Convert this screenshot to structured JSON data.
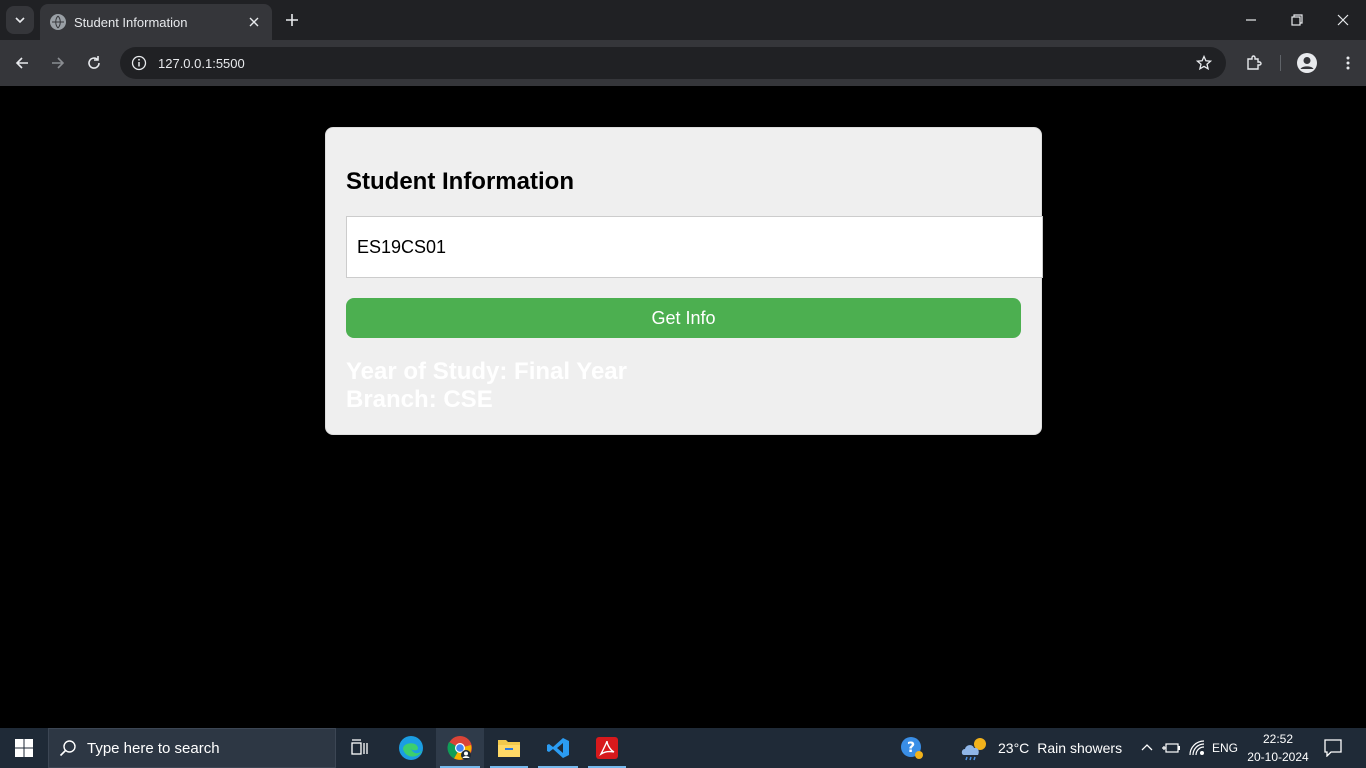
{
  "browser": {
    "tab_title": "Student Information",
    "url": "127.0.0.1:5500"
  },
  "page": {
    "heading": "Student Information",
    "student_id_value": "ES19CS01",
    "button_label": "Get Info",
    "result_year": "Year of Study: Final Year",
    "result_branch": "Branch: CSE",
    "button_color": "#4caf50",
    "card_color": "#efefef"
  },
  "taskbar": {
    "search_placeholder": "Type here to search",
    "weather_temp": "23°C",
    "weather_desc": "Rain showers",
    "language": "ENG",
    "time": "22:52",
    "date": "20-10-2024",
    "pinned_apps": [
      "task-view",
      "edge",
      "chrome",
      "file-explorer",
      "vs-code",
      "acrobat"
    ]
  }
}
